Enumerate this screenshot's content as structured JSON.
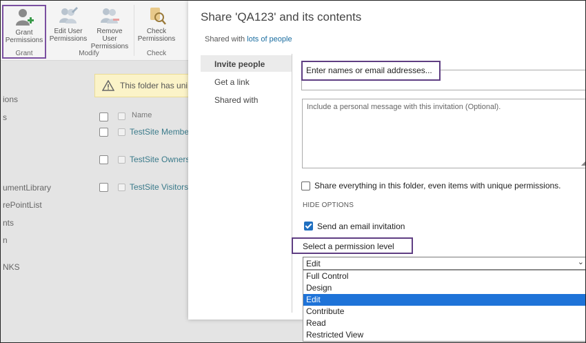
{
  "ribbon": {
    "buttons": [
      {
        "label": "Grant Permissions",
        "icon": "add-user-icon"
      },
      {
        "label": "Edit User Permissions",
        "icon": "edit-users-icon"
      },
      {
        "label": "Remove User Permissions",
        "icon": "remove-users-icon"
      },
      {
        "label": "Check Permissions",
        "icon": "check-permissions-icon"
      }
    ],
    "groups": [
      "Grant",
      "Modify",
      "Check"
    ]
  },
  "background": {
    "left_nav": [
      "ions",
      "s",
      "umentLibrary",
      "rePointList",
      "nts",
      "n",
      "NKS"
    ],
    "warning_text": "This folder has uni",
    "column_name": "Name",
    "rows": [
      "TestSite Member",
      "TestSite Owners",
      "TestSite Visitors"
    ]
  },
  "dialog": {
    "title": "Share 'QA123' and its contents",
    "shared_with_prefix": "Shared with",
    "shared_with_link": "lots of people",
    "tabs": [
      "Invite people",
      "Get a link",
      "Shared with"
    ],
    "names_placeholder": "Enter names or email addresses...",
    "message_placeholder": "Include a personal message with this invitation (Optional).",
    "share_everything_label": "Share everything in this folder, even items with unique permissions.",
    "share_everything_checked": false,
    "hide_options": "HIDE OPTIONS",
    "send_email_label": "Send an email invitation",
    "send_email_checked": true,
    "permission_heading": "Select a permission level",
    "permission_selected": "Edit",
    "permission_options": [
      "Full Control",
      "Design",
      "Edit",
      "Contribute",
      "Read",
      "Restricted View"
    ]
  },
  "colors": {
    "highlight_border": "#5e3d82",
    "link": "#1a6da0",
    "selected_option": "#1e73d8",
    "warning_bg": "#fbf3c8"
  }
}
